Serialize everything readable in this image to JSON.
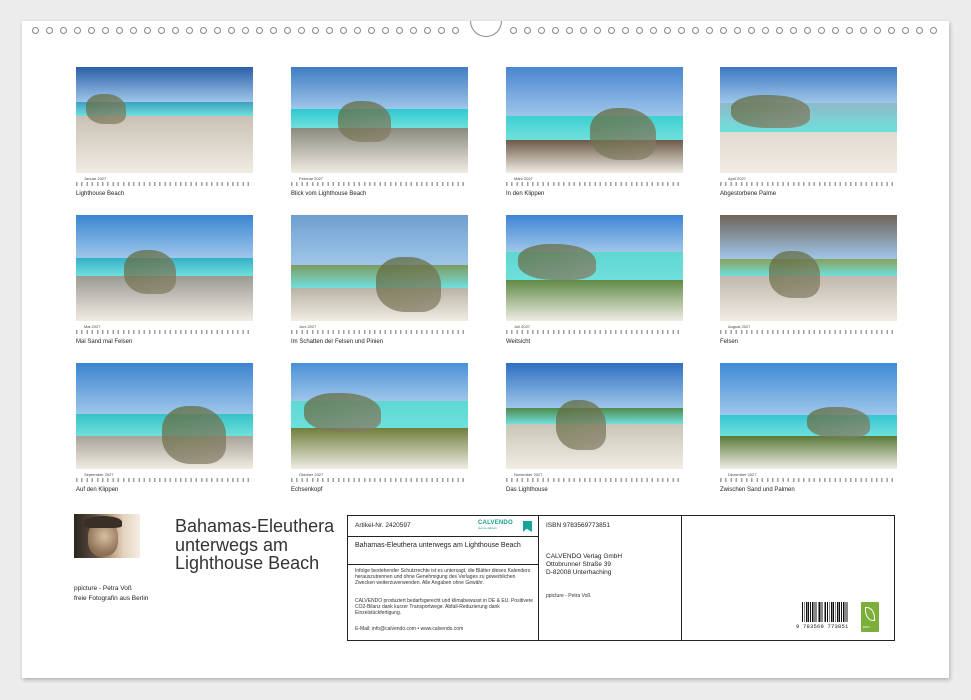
{
  "months": [
    {
      "month": "Januar 2027",
      "caption": "Lighthouse Beach",
      "colors": [
        "#2b5fa8",
        "#3da0c2",
        "#c9c1b3"
      ]
    },
    {
      "month": "Februar 2027",
      "caption": "Blick vom  Lighthouse Beach",
      "colors": [
        "#3f7cc2",
        "#2ec8d0",
        "#8a8a7e"
      ]
    },
    {
      "month": "März 2027",
      "caption": "In den Klippen",
      "colors": [
        "#4a85d0",
        "#3fd0d0",
        "#6b5a48"
      ]
    },
    {
      "month": "April 2027",
      "caption": "Abgestorbene Palme",
      "colors": [
        "#3d78c0",
        "#8fb8c8",
        "#e1dbd0"
      ]
    },
    {
      "month": "Mai 2027",
      "caption": "Mal Sand mal Felsen",
      "colors": [
        "#3a86d2",
        "#35b0c8",
        "#9b9a93"
      ]
    },
    {
      "month": "Juni 2027",
      "caption": "Im Schatten der Felsen und Pinien",
      "colors": [
        "#6f9fcf",
        "#7f9a60",
        "#b9b3a5"
      ]
    },
    {
      "month": "Juli 2027",
      "caption": "Weitsicht",
      "colors": [
        "#3e84d4",
        "#5fd6d0",
        "#5f8a45"
      ]
    },
    {
      "month": "August 2027",
      "caption": "Felsen",
      "colors": [
        "#6f645a",
        "#8aa05a",
        "#c0b8ac"
      ]
    },
    {
      "month": "September 2027",
      "caption": "Auf den Klippen",
      "colors": [
        "#3c84cf",
        "#37c2c6",
        "#a7a396"
      ]
    },
    {
      "month": "Oktober 2027",
      "caption": "Echsenkopf",
      "colors": [
        "#4a90d6",
        "#5cd8d2",
        "#6f7f3e"
      ]
    },
    {
      "month": "November 2027",
      "caption": "Das Lighthouse",
      "colors": [
        "#2f6fc0",
        "#4f8a4a",
        "#c8c6b8"
      ]
    },
    {
      "month": "Dezember 2027",
      "caption": "Zwischen Sand und Palmen",
      "colors": [
        "#3d8ad6",
        "#38c6d2",
        "#5a7a3a"
      ]
    }
  ],
  "title": "Bahamas-Eleuthera unterwegs am Lighthouse Beach",
  "author": {
    "name": "ppicture - Petra Voß",
    "description": "freie Fotografin aus Berlin"
  },
  "info": {
    "artikel": "Artikel-Nr. 2420597",
    "brand": "CALVENDO",
    "brand_tagline": "Gerne daheim",
    "product_title": "Bahamas-Eleuthera unterwegs am Lighthouse Beach",
    "legal1": "Infolge bestehender Schutzrechte ist es untersagt, die Blätter dieses Kalenders herauszutrennen und ohne Genehmigung des Verlages zu gewerblichen Zwecken weiterzuverwenden. Alle Angaben ohne Gewähr.",
    "legal2": "CALVENDO produziert bedarfsgerecht und klimabewusst in DE & EU. Positivere CO2-Bilanz dank kurzer Transportwege. Abfall-Reduzierung dank Einzelstückfertigung.",
    "contact": "E-Mail: info@calvendo.com • www.calvendo.com",
    "isbn": "ISBN 9783569773851",
    "publisher_line1": "CALVENDO Verlag GmbH",
    "publisher_line2": "Ottobrunner Straße 39",
    "publisher_line3": "D-82008 Unterhaching",
    "photo_credit": "ppicture - Petra Voß",
    "barcode_digits": "9 783569 773851",
    "eco_label": "eco"
  }
}
